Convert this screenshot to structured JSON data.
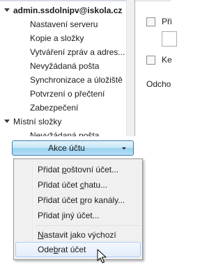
{
  "tree": {
    "account": "admin.ssdolnipv@iskola.cz",
    "items": [
      "Nastavení serveru",
      "Kopie a složky",
      "Vytváření zpráv a adres...",
      "Nevyžádaná pošta",
      "Synchronizace a úložiště",
      "Potvrzení o přečtení",
      "Zabezpečení"
    ],
    "local_folders": "Místní složky",
    "local_items": [
      "Nevyžádaná pošta"
    ]
  },
  "right_pane": {
    "label_1": "Při",
    "label_2": "Ke",
    "label_3": "Odcho"
  },
  "action_button": {
    "label": "Akce účtu"
  },
  "menu": {
    "items": [
      {
        "pre": "Přidat ",
        "ul": "p",
        "post": "oštovní účet..."
      },
      {
        "pre": "Přidat účet ",
        "ul": "c",
        "post": "hatu..."
      },
      {
        "pre": "Přidat účet ",
        "ul": "p",
        "post": "ro kanály..."
      },
      {
        "pre": "Přidat ",
        "ul": "j",
        "post": "iný účet..."
      },
      {
        "pre": "",
        "ul": "N",
        "post": "astavit jako výchozí"
      },
      {
        "pre": "Ode",
        "ul": "b",
        "post": "rat účet"
      }
    ]
  }
}
